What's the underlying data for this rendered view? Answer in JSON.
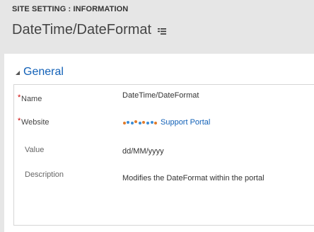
{
  "header": {
    "breadcrumb": "SITE SETTING : INFORMATION",
    "title": "DateTime/DateFormat",
    "menu_icon": "list-menu-icon"
  },
  "section": {
    "title": "General",
    "collapse_icon": "collapse-triangle-icon"
  },
  "fields": {
    "name": {
      "label": "Name",
      "required": "*",
      "value": "DateTime/DateFormat"
    },
    "website": {
      "label": "Website",
      "required": "*",
      "value": "Support Portal",
      "logo_icon": "company-logo-icon"
    },
    "value": {
      "label": "Value",
      "value": "dd/MM/yyyy"
    },
    "description": {
      "label": "Description",
      "value": "Modifies the DateFormat within the portal"
    }
  },
  "colors": {
    "accent": "#1160b7",
    "required": "#c00000",
    "background": "#e6e6e6"
  }
}
